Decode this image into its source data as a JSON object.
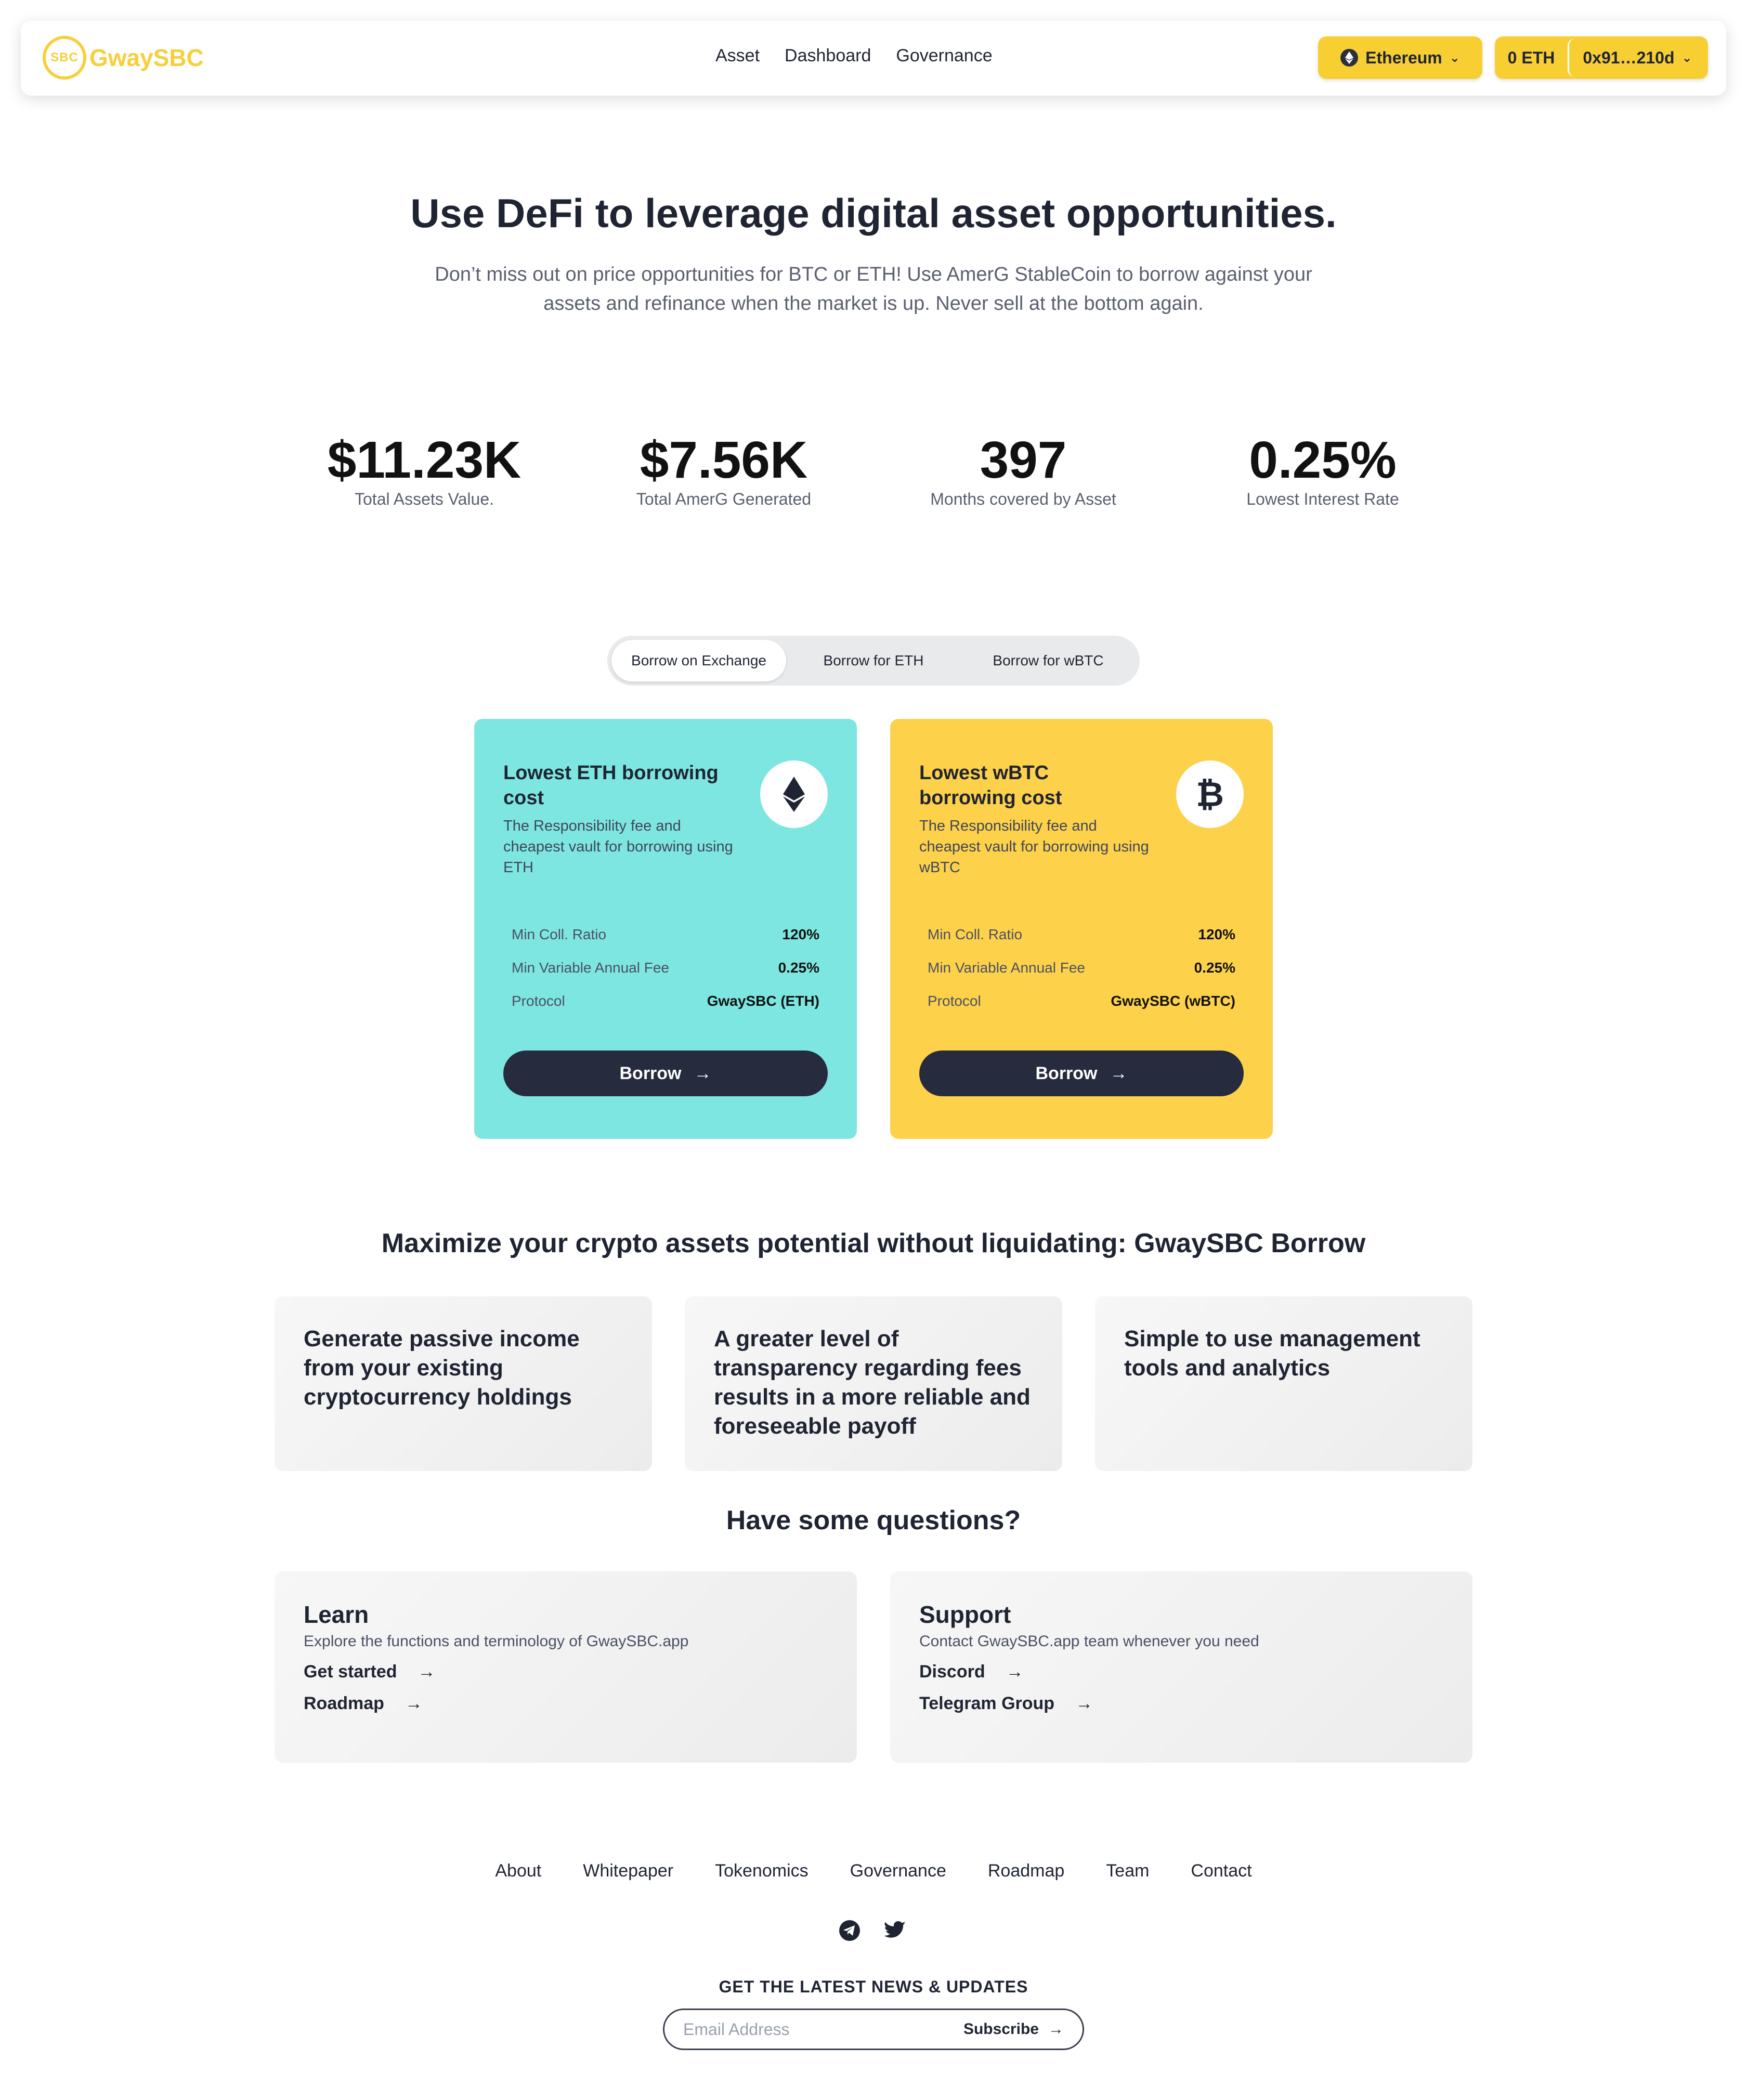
{
  "brand": {
    "logo_mark": "SBC",
    "name": "GwaySBC",
    "color": "#f6cf3a"
  },
  "nav": {
    "links": [
      "Asset",
      "Dashboard",
      "Governance"
    ]
  },
  "network": {
    "label": "Ethereum",
    "icon": "ethereum-icon"
  },
  "wallet": {
    "balance": "0 ETH",
    "address": "0x91…210d"
  },
  "hero": {
    "title": "Use DeFi to leverage digital asset opportunities.",
    "subtitle": "Don’t miss out on price opportunities for BTC or ETH! Use AmerG StableCoin to borrow against your assets and refinance when the market is up. Never sell at the bottom again."
  },
  "stats": [
    {
      "value": "$11.23K",
      "label": "Total Assets Value."
    },
    {
      "value": "$7.56K",
      "label": "Total AmerG Generated"
    },
    {
      "value": "397",
      "label": "Months covered by Asset"
    },
    {
      "value": "0.25%",
      "label": "Lowest Interest Rate"
    }
  ],
  "tabs": [
    "Borrow on Exchange",
    "Borrow for ETH",
    "Borrow for wBTC"
  ],
  "active_tab": "Borrow on Exchange",
  "borrow_cards": [
    {
      "title": "Lowest ETH borrowing cost",
      "desc": "The Responsibility fee and cheapest vault for borrowing using ETH",
      "icon": "ethereum-icon",
      "color": "#7de6e0",
      "rows": [
        {
          "label": "Min Coll. Ratio",
          "value": "120%"
        },
        {
          "label": "Min Variable Annual Fee",
          "value": "0.25%"
        },
        {
          "label": "Protocol",
          "value": "GwaySBC (ETH)"
        }
      ],
      "button": "Borrow"
    },
    {
      "title": "Lowest wBTC borrowing cost",
      "desc": "The Responsibility fee and cheapest vault for borrowing using wBTC",
      "icon": "bitcoin-icon",
      "color": "#fdd14a",
      "rows": [
        {
          "label": "Min Coll. Ratio",
          "value": "120%"
        },
        {
          "label": "Min Variable Annual Fee",
          "value": "0.25%"
        },
        {
          "label": "Protocol",
          "value": "GwaySBC (wBTC)"
        }
      ],
      "button": "Borrow"
    }
  ],
  "features": {
    "title": "Maximize your crypto assets potential without liquidating: GwaySBC Borrow",
    "items": [
      "Generate passive income from your existing cryptocurrency holdings",
      "A greater level of transparency regarding fees results in a more reliable and foreseeable payoff",
      "Simple to use management tools and analytics"
    ]
  },
  "questions": {
    "title": "Have some questions?",
    "cards": [
      {
        "title": "Learn",
        "subtitle": "Explore the functions and terminology of GwaySBC.app",
        "links": [
          "Get started",
          "Roadmap"
        ]
      },
      {
        "title": "Support",
        "subtitle": "Contact GwaySBC.app team whenever you need",
        "links": [
          "Discord",
          "Telegram Group"
        ]
      }
    ]
  },
  "footer": {
    "links": [
      "About",
      "Whitepaper",
      "Tokenomics",
      "Governance",
      "Roadmap",
      "Team",
      "Contact"
    ],
    "socials": [
      "telegram-icon",
      "twitter-icon"
    ],
    "newsletter_title": "GET THE LATEST NEWS & UPDATES",
    "email_placeholder": "Email Address",
    "subscribe_label": "Subscribe"
  }
}
